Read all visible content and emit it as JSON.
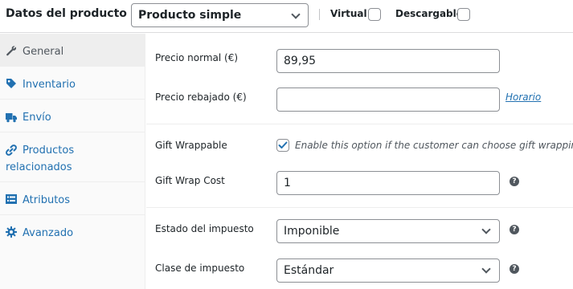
{
  "header": {
    "title": "Datos del producto —",
    "product_type": "Producto simple",
    "virtual_label": "Virtual:",
    "downloadable_label": "Descargable:"
  },
  "sidebar": {
    "items": [
      {
        "label": "General",
        "icon": "wrench-icon",
        "active": true
      },
      {
        "label": "Inventario",
        "icon": "tag-icon"
      },
      {
        "label": "Envío",
        "icon": "truck-icon"
      },
      {
        "label_line1": "Productos",
        "label_line2": "relacionados",
        "icon": "link-icon"
      },
      {
        "label": "Atributos",
        "icon": "list-icon"
      },
      {
        "label": "Avanzado",
        "icon": "gear-icon"
      }
    ]
  },
  "general": {
    "regular_price_label": "Precio normal (€)",
    "regular_price_value": "89,95",
    "sale_price_label": "Precio rebajado (€)",
    "sale_price_value": "",
    "schedule_link": "Horario",
    "gift_wrappable_label": "Gift Wrappable",
    "gift_wrappable_checked": true,
    "gift_wrappable_desc": "Enable this option if the customer can choose gift wrapping.",
    "gift_wrap_cost_label": "Gift Wrap Cost",
    "gift_wrap_cost_value": "1",
    "tax_status_label": "Estado del impuesto",
    "tax_status_value": "Imponible",
    "tax_class_label": "Clase de impuesto",
    "tax_class_value": "Estándar",
    "help_glyph": "?"
  },
  "colors": {
    "link": "#2271b1",
    "check": "#2271b1",
    "border": "#8c8f94"
  }
}
